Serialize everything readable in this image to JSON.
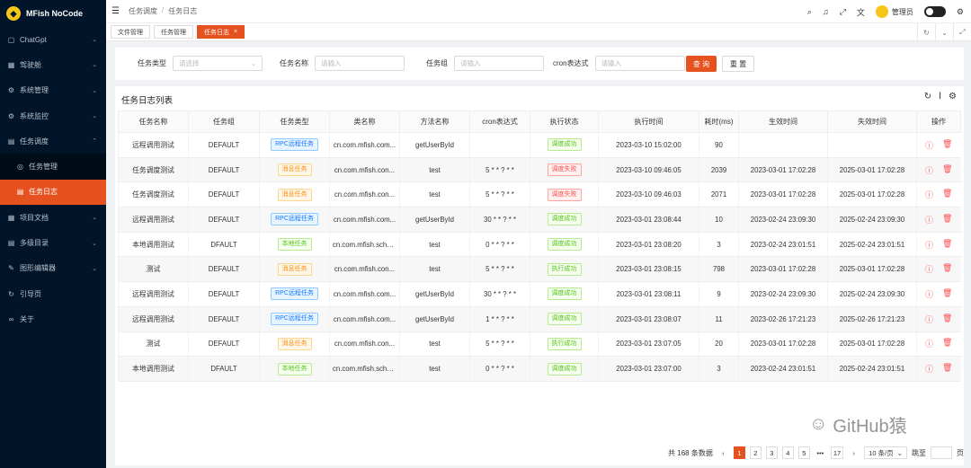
{
  "app": {
    "logo": "MFish NoCode"
  },
  "sidebar": {
    "items": [
      {
        "label": "ChatGpt",
        "icon": "chat-icon",
        "chev": "⌄"
      },
      {
        "label": "驾驶舱",
        "icon": "dashboard-icon",
        "chev": "⌄"
      },
      {
        "label": "系统管理",
        "icon": "gear-icon",
        "chev": "⌄"
      },
      {
        "label": "系统监控",
        "icon": "monitor-icon",
        "chev": "⌄"
      },
      {
        "label": "任务调度",
        "icon": "schedule-icon",
        "chev": "⌃"
      },
      {
        "label": "任务管理",
        "icon": "task-icon"
      },
      {
        "label": "任务日志",
        "icon": "log-icon"
      },
      {
        "label": "项目文档",
        "icon": "doc-icon",
        "chev": "⌄"
      },
      {
        "label": "多级目录",
        "icon": "folder-icon",
        "chev": "⌄"
      },
      {
        "label": "图形编辑器",
        "icon": "editor-icon",
        "chev": "⌄"
      },
      {
        "label": "引导页",
        "icon": "guide-icon"
      },
      {
        "label": "关于",
        "icon": "about-icon"
      }
    ]
  },
  "header": {
    "breadcrumb": [
      "任务调度",
      "任务日志"
    ],
    "user": "管理员"
  },
  "tabs": [
    {
      "label": "文件管理"
    },
    {
      "label": "任务管理"
    },
    {
      "label": "任务日志",
      "close": "×"
    }
  ],
  "search": {
    "type_label": "任务类型",
    "type_placeholder": "请选择",
    "name_label": "任务名称",
    "name_placeholder": "请输入",
    "group_label": "任务组",
    "group_placeholder": "请输入",
    "cron_label": "cron表达式",
    "cron_placeholder": "请输入",
    "query": "查 询",
    "reset": "重 置"
  },
  "table": {
    "title": "任务日志列表",
    "columns": [
      "任务名称",
      "任务组",
      "任务类型",
      "类名称",
      "方法名称",
      "cron表达式",
      "执行状态",
      "执行时间",
      "耗时(ms)",
      "生效时间",
      "失效时间",
      "操作"
    ],
    "rows": [
      {
        "name": "远程调用测试",
        "group": "DEFAULT",
        "type": "RPC远程任务",
        "typeColor": "blue",
        "cls": "cn.com.mfish.com...",
        "method": "getUserById",
        "cron": "",
        "status": "调度成功",
        "statusColor": "green",
        "exec": "2023-03-10 15:02:00",
        "cost": "90",
        "start": "",
        "end": ""
      },
      {
        "name": "任务调度测试",
        "group": "DEFAULT",
        "type": "消息任务",
        "typeColor": "orange",
        "cls": "cn.com.mfish.con...",
        "method": "test",
        "cron": "5 * * ? * *",
        "status": "调度失败",
        "statusColor": "red",
        "exec": "2023-03-10 09:46:05",
        "cost": "2039",
        "start": "2023-03-01 17:02:28",
        "end": "2025-03-01 17:02:28"
      },
      {
        "name": "任务调度测试",
        "group": "DEFAULT",
        "type": "消息任务",
        "typeColor": "orange",
        "cls": "cn.com.mfish.con...",
        "method": "test",
        "cron": "5 * * ? * *",
        "status": "调度失败",
        "statusColor": "red",
        "exec": "2023-03-10 09:46:03",
        "cost": "2071",
        "start": "2023-03-01 17:02:28",
        "end": "2025-03-01 17:02:28"
      },
      {
        "name": "远程调用测试",
        "group": "DEFAULT",
        "type": "RPC远程任务",
        "typeColor": "blue",
        "cls": "cn.com.mfish.com...",
        "method": "getUserById",
        "cron": "30 * * ? * *",
        "status": "调度成功",
        "statusColor": "green",
        "exec": "2023-03-01 23:08:44",
        "cost": "10",
        "start": "2023-02-24 23:09:30",
        "end": "2025-02-24 23:09:30"
      },
      {
        "name": "本地调用测试",
        "group": "DFAULT",
        "type": "本地任务",
        "typeColor": "green",
        "cls": "cn.com.mfish.sche...",
        "method": "test",
        "cron": "0 * * ? * *",
        "status": "调度成功",
        "statusColor": "green",
        "exec": "2023-03-01 23:08:20",
        "cost": "3",
        "start": "2023-02-24 23:01:51",
        "end": "2025-02-24 23:01:51"
      },
      {
        "name": "测试",
        "group": "DEFAULT",
        "type": "消息任务",
        "typeColor": "orange",
        "cls": "cn.com.mfish.con...",
        "method": "test",
        "cron": "5 * * ? * *",
        "status": "执行成功",
        "statusColor": "green",
        "exec": "2023-03-01 23:08:15",
        "cost": "798",
        "start": "2023-03-01 17:02:28",
        "end": "2025-03-01 17:02:28"
      },
      {
        "name": "远程调用测试",
        "group": "DEFAULT",
        "type": "RPC远程任务",
        "typeColor": "blue",
        "cls": "cn.com.mfish.com...",
        "method": "getUserById",
        "cron": "30 * * ? * *",
        "status": "调度成功",
        "statusColor": "green",
        "exec": "2023-03-01 23:08:11",
        "cost": "9",
        "start": "2023-02-24 23:09:30",
        "end": "2025-02-24 23:09:30"
      },
      {
        "name": "远程调用测试",
        "group": "DEFAULT",
        "type": "RPC远程任务",
        "typeColor": "blue",
        "cls": "cn.com.mfish.com...",
        "method": "getUserById",
        "cron": "1 * * ? * *",
        "status": "调度成功",
        "statusColor": "green",
        "exec": "2023-03-01 23:08:07",
        "cost": "11",
        "start": "2023-02-26 17:21:23",
        "end": "2025-02-26 17:21:23"
      },
      {
        "name": "测试",
        "group": "DEFAULT",
        "type": "消息任务",
        "typeColor": "orange",
        "cls": "cn.com.mfish.con...",
        "method": "test",
        "cron": "5 * * ? * *",
        "status": "执行成功",
        "statusColor": "green",
        "exec": "2023-03-01 23:07:05",
        "cost": "20",
        "start": "2023-03-01 17:02:28",
        "end": "2025-03-01 17:02:28"
      },
      {
        "name": "本地调用测试",
        "group": "DFAULT",
        "type": "本地任务",
        "typeColor": "green",
        "cls": "cn.com.mfish.sche...",
        "method": "test",
        "cron": "0 * * ? * *",
        "status": "调度成功",
        "statusColor": "green",
        "exec": "2023-03-01 23:07:00",
        "cost": "3",
        "start": "2023-02-24 23:01:51",
        "end": "2025-02-24 23:01:51"
      }
    ]
  },
  "pagination": {
    "total": "共 168 条数据",
    "pages": [
      "1",
      "2",
      "3",
      "4",
      "5",
      "•••",
      "17"
    ],
    "current": "1",
    "size": "10 条/页",
    "jump": "跳至",
    "page_unit": "页"
  },
  "watermark": "GitHub猿",
  "colors": {
    "accent": "#e6521f",
    "sidebar": "#001529"
  }
}
